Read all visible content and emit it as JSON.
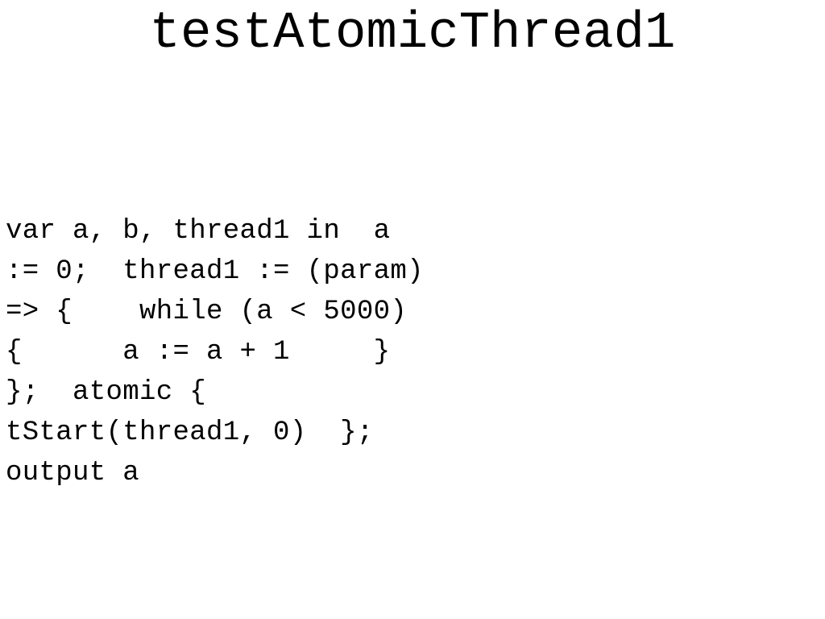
{
  "slide": {
    "title": "testAtomicThread1",
    "background_color": "#ffffff",
    "text_color": "#000000",
    "body_lines": [
      "var a, b, thread1 in  a",
      ":= 0;  thread1 := (param)",
      "=> {    while (a < 5000)",
      "{      a := a + 1     }",
      "};  atomic {",
      "tStart(thread1, 0)  };",
      "output a"
    ]
  }
}
